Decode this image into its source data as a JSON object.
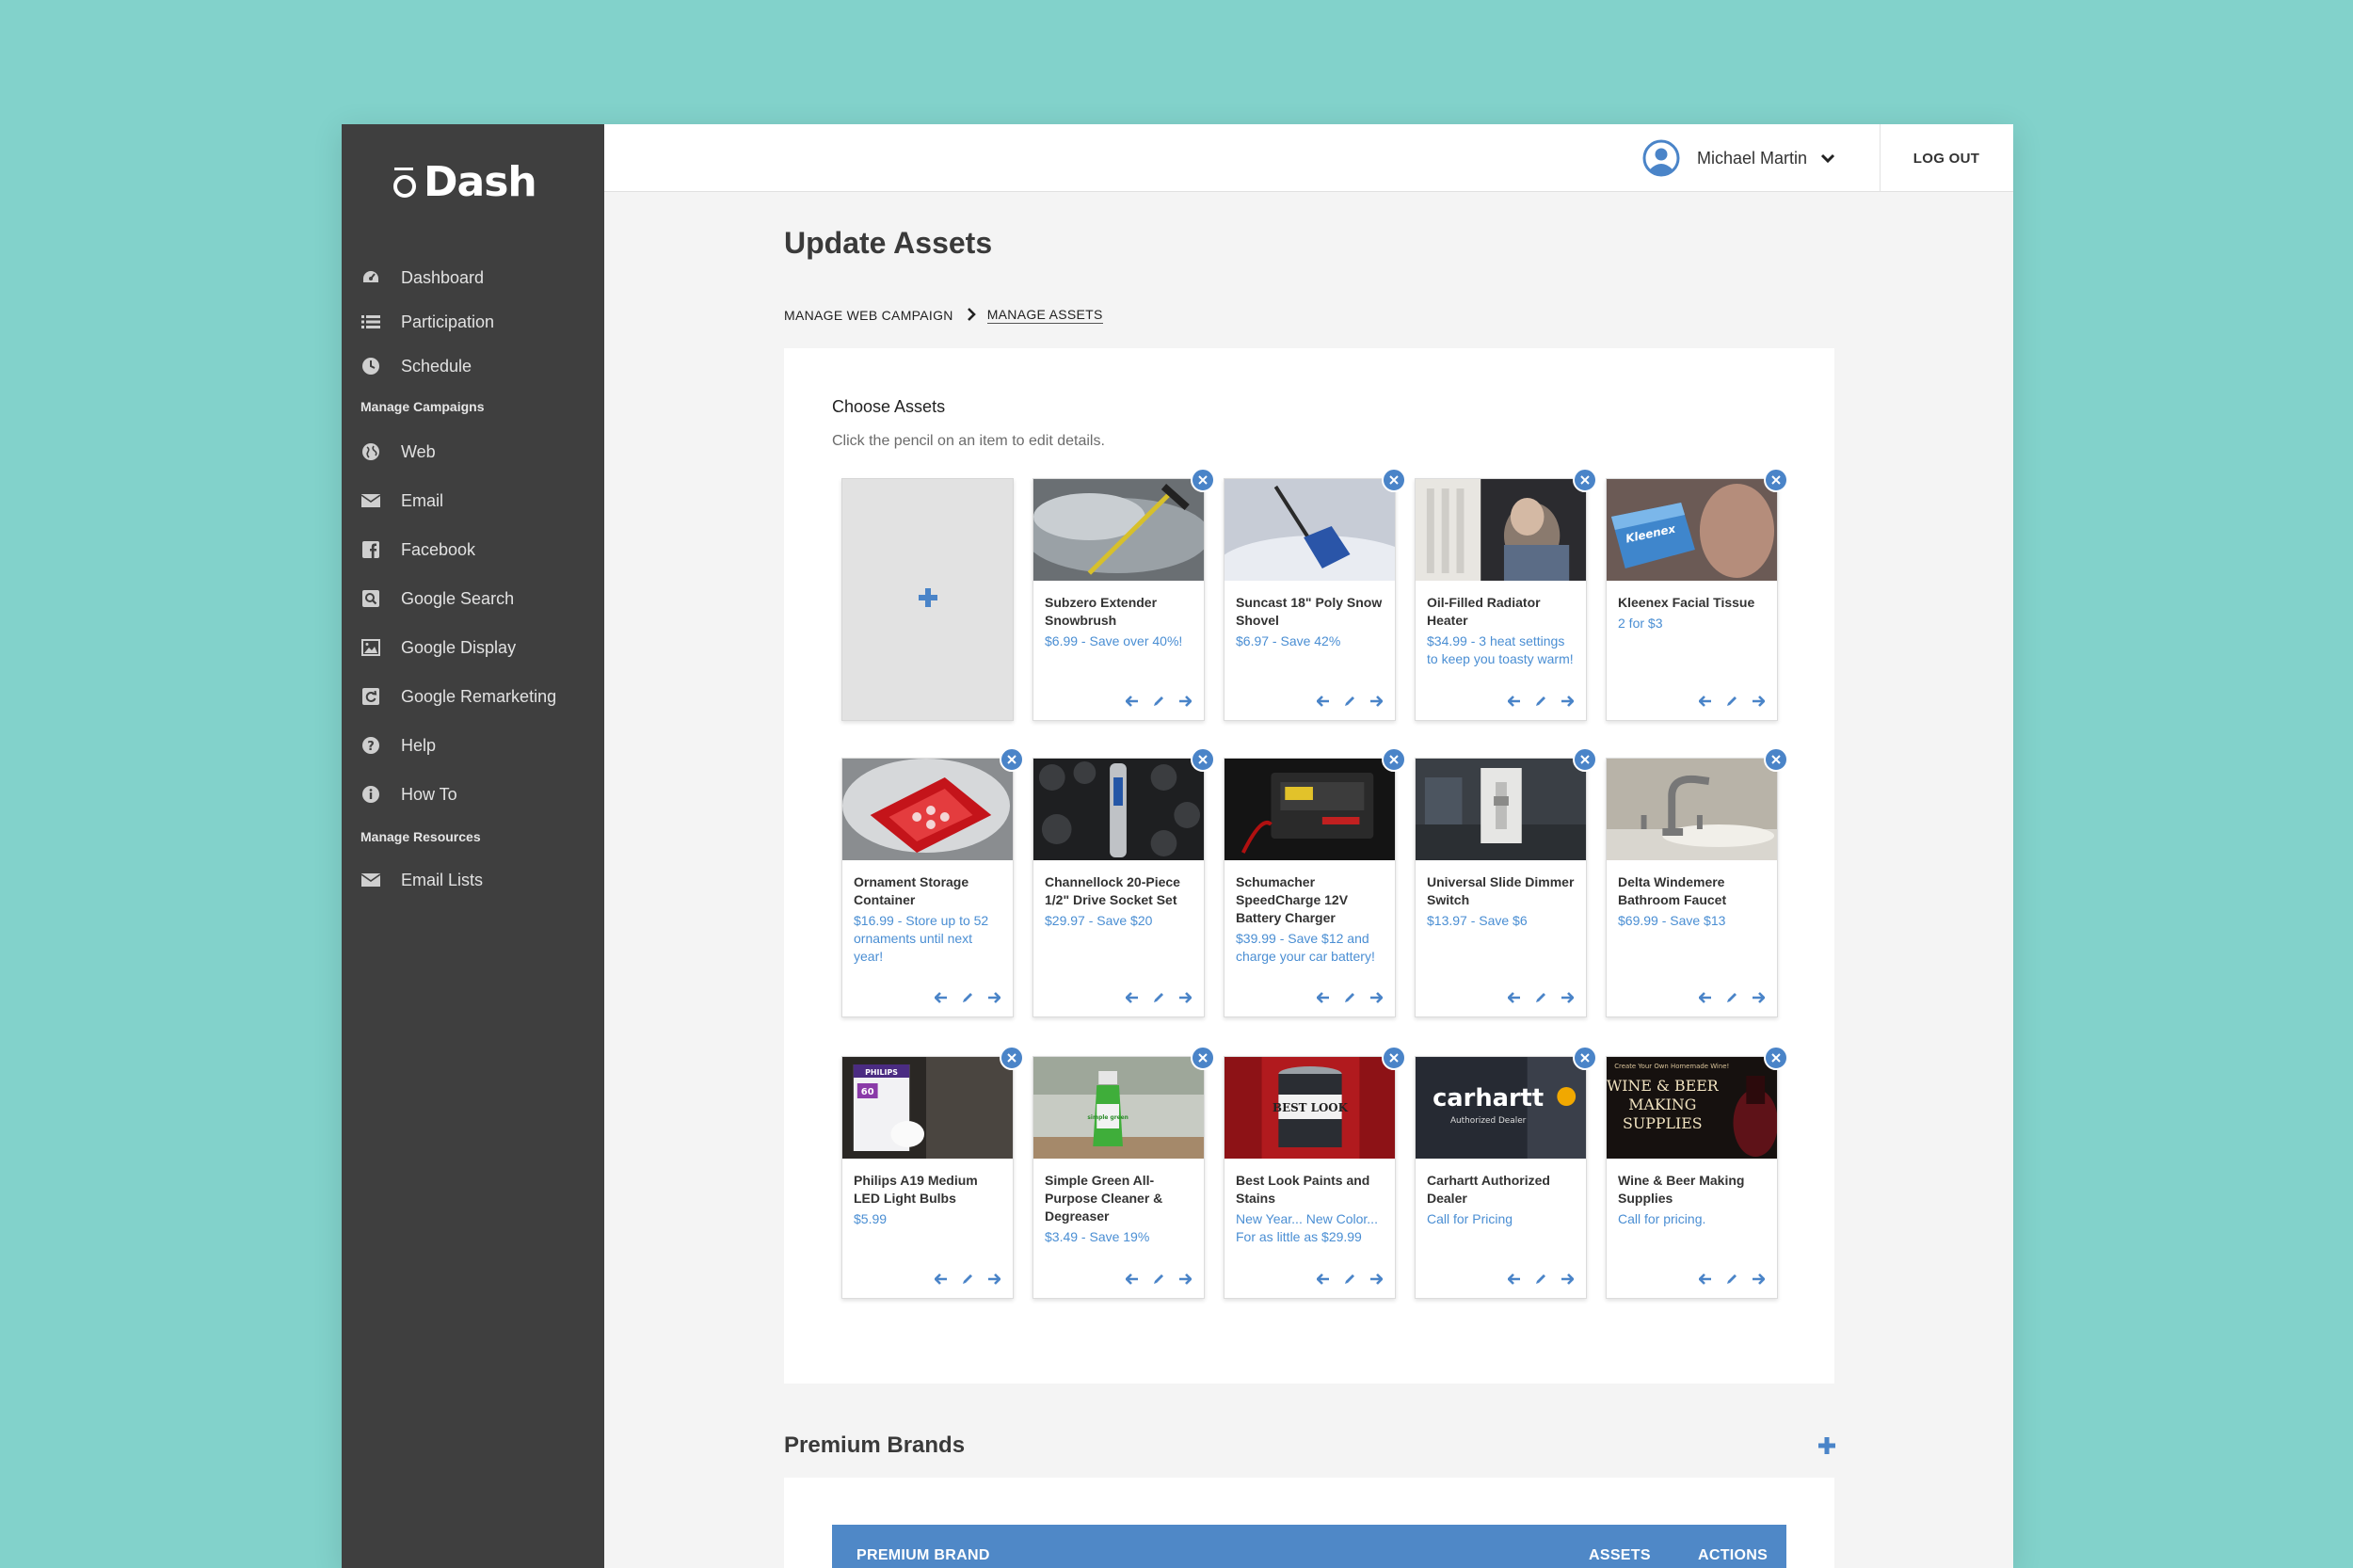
{
  "app": {
    "brand": "Dash"
  },
  "sidebar": {
    "items": [
      {
        "label": "Dashboard",
        "icon": "dashboard-icon"
      },
      {
        "label": "Participation",
        "icon": "list-icon"
      },
      {
        "label": "Schedule",
        "icon": "clock-icon"
      },
      {
        "label": "Web",
        "icon": "globe-icon"
      },
      {
        "label": "Email",
        "icon": "envelope-icon"
      },
      {
        "label": "Facebook",
        "icon": "facebook-icon"
      },
      {
        "label": "Google Search",
        "icon": "search-square-icon"
      },
      {
        "label": "Google Display",
        "icon": "image-icon"
      },
      {
        "label": "Google Remarketing",
        "icon": "refresh-square-icon"
      },
      {
        "label": "Help",
        "icon": "question-circle-icon"
      },
      {
        "label": "How To",
        "icon": "info-circle-icon"
      },
      {
        "label": "Email Lists",
        "icon": "envelope-icon"
      }
    ],
    "sections": {
      "manage_campaigns": "Manage Campaigns",
      "manage_resources": "Manage Resources"
    }
  },
  "topbar": {
    "user_name": "Michael Martin",
    "logout_label": "LOG OUT"
  },
  "page": {
    "title": "Update Assets",
    "breadcrumb": [
      "MANAGE WEB CAMPAIGN",
      "MANAGE ASSETS"
    ]
  },
  "assets_card": {
    "title": "Choose Assets",
    "subtitle": "Click the pencil on an item to edit details.",
    "tiles": [
      {
        "name": "Subzero Extender Snowbrush",
        "price": "$6.99 - Save over 40%!"
      },
      {
        "name": "Suncast 18\" Poly Snow Shovel",
        "price": "$6.97 - Save 42%"
      },
      {
        "name": "Oil-Filled Radiator Heater",
        "price": "$34.99 - 3 heat settings to keep you toasty warm!"
      },
      {
        "name": "Kleenex Facial Tissue",
        "price": "2 for $3"
      },
      {
        "name": "Ornament Storage Container",
        "price": "$16.99 - Store up to 52 ornaments until next year!"
      },
      {
        "name": "Channellock 20-Piece 1/2\" Drive Socket Set",
        "price": "$29.97 - Save $20"
      },
      {
        "name": "Schumacher SpeedCharge 12V Battery Charger",
        "price": "$39.99 - Save $12 and charge your car battery!"
      },
      {
        "name": "Universal Slide Dimmer Switch",
        "price": "$13.97 - Save $6"
      },
      {
        "name": "Delta Windemere Bathroom Faucet",
        "price": "$69.99 - Save $13"
      },
      {
        "name": "Philips A19 Medium LED Light Bulbs",
        "price": "$5.99"
      },
      {
        "name": "Simple Green All-Purpose Cleaner & Degreaser",
        "price": "$3.49 - Save 19%"
      },
      {
        "name": "Best Look Paints and Stains",
        "price": "New Year... New Color... For as little as $29.99"
      },
      {
        "name": "Carhartt Authorized Dealer",
        "price": "Call for Pricing"
      },
      {
        "name": "Wine & Beer Making Supplies",
        "price": "Call for pricing."
      }
    ],
    "thumb_text": {
      "kleenex": "Kleenex",
      "philips": "PHILIPS",
      "philips_watt": "60",
      "simple_green": "simple green",
      "best_look": "BEST LOOK",
      "carhartt": "carhartt",
      "carhartt_sub": "Authorized Dealer",
      "wine_small": "Create Your Own Homemade Wine!",
      "wine_line1": "WINE & BEER",
      "wine_line2": "MAKING",
      "wine_line3": "SUPPLIES"
    }
  },
  "premium": {
    "title": "Premium Brands",
    "columns": [
      "PREMIUM BRAND",
      "ASSETS",
      "ACTIONS"
    ]
  },
  "colors": {
    "accent": "#4a84c8",
    "sidebar": "#3f3f3f",
    "background": "#82d2cb"
  }
}
